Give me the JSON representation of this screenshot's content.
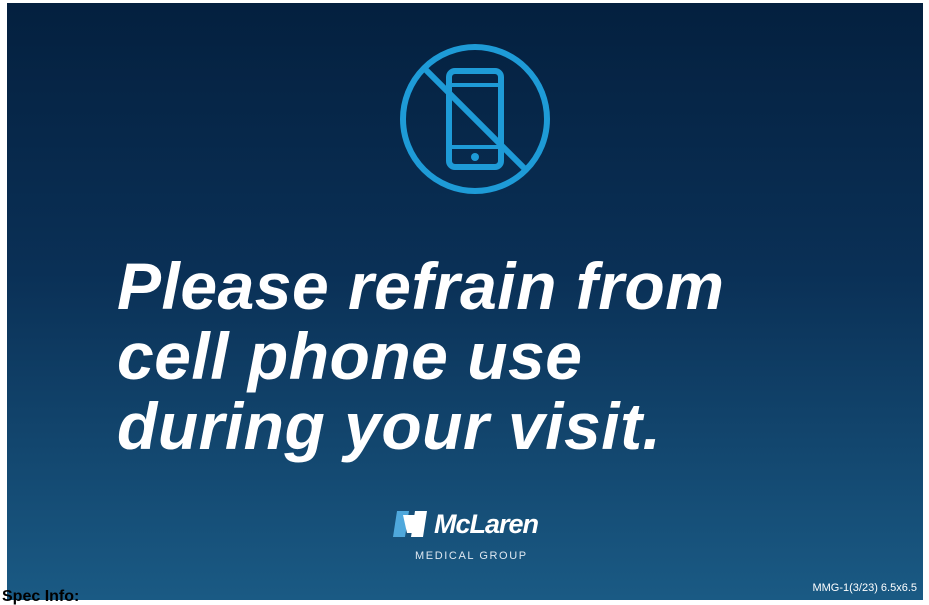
{
  "sign": {
    "icon": "no-cell-phone-icon",
    "headline_lines": [
      "Please refrain from",
      "cell phone use",
      "during your visit."
    ],
    "logo": {
      "icon": "mclaren-m-logo-icon",
      "name": "McLaren",
      "subtitle": "MEDICAL GROUP"
    },
    "spec_code": "MMG-1(3/23) 6.5x6.5"
  },
  "footer": {
    "spec_label": "Spec Info:"
  },
  "colors": {
    "background_top": "#04203f",
    "background_bottom": "#1a5a84",
    "icon_blue": "#1e9bd7",
    "text": "#ffffff"
  }
}
